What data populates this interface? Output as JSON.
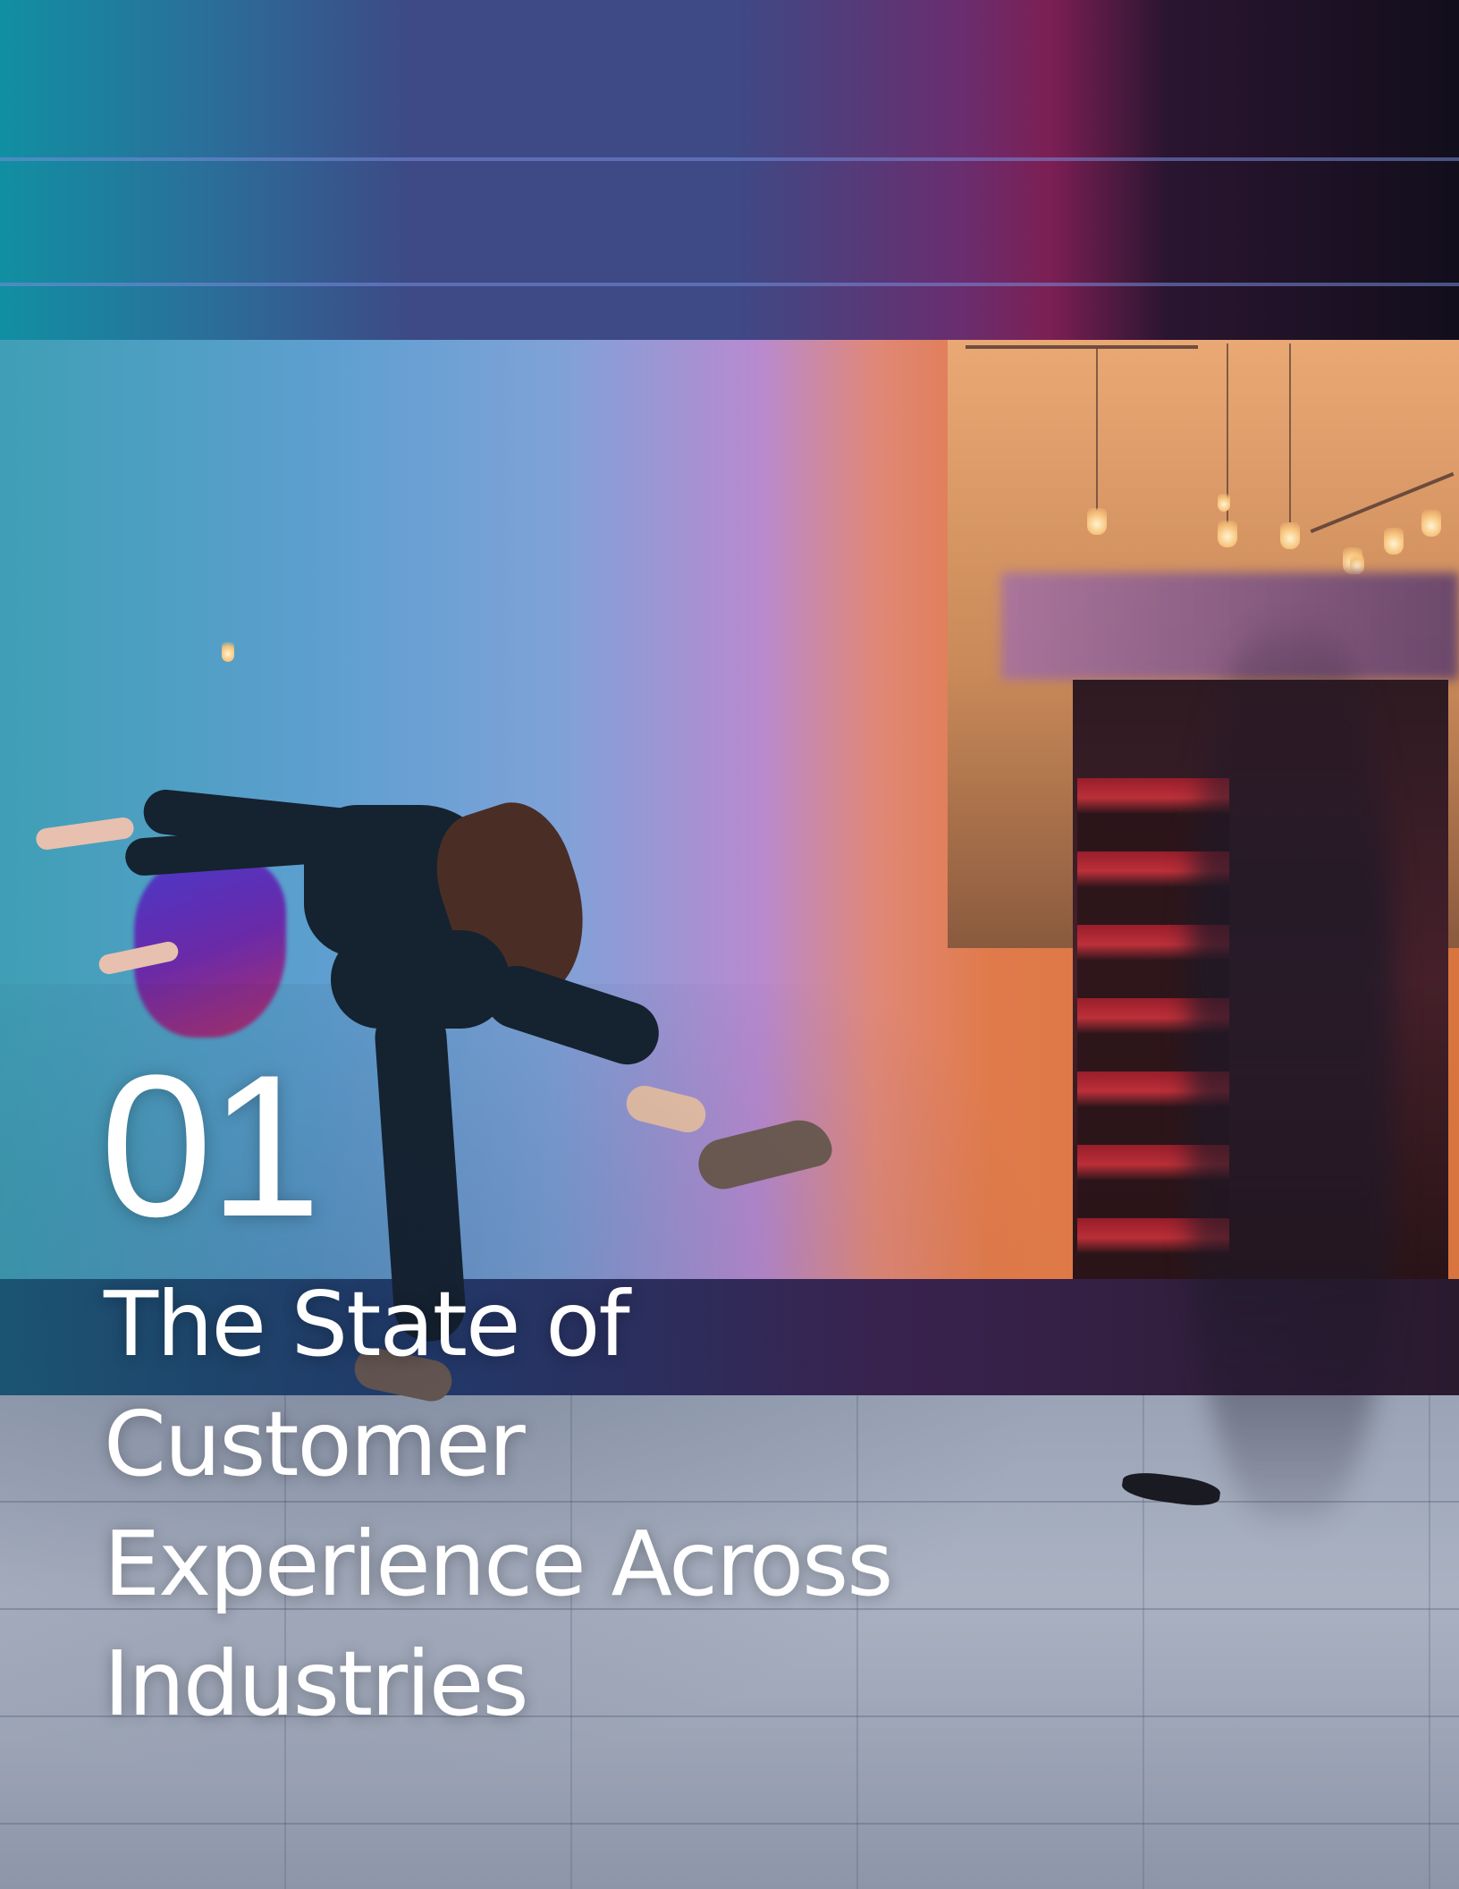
{
  "cover": {
    "section_number": "01",
    "title_lines": [
      "The State of",
      "Customer",
      "Experience Across",
      "Industries"
    ]
  },
  "colors": {
    "text": "#ffffff",
    "wall_left": "#3f9fb5",
    "wall_mid": "#b88ad0",
    "wall_right": "#e07a4a"
  }
}
